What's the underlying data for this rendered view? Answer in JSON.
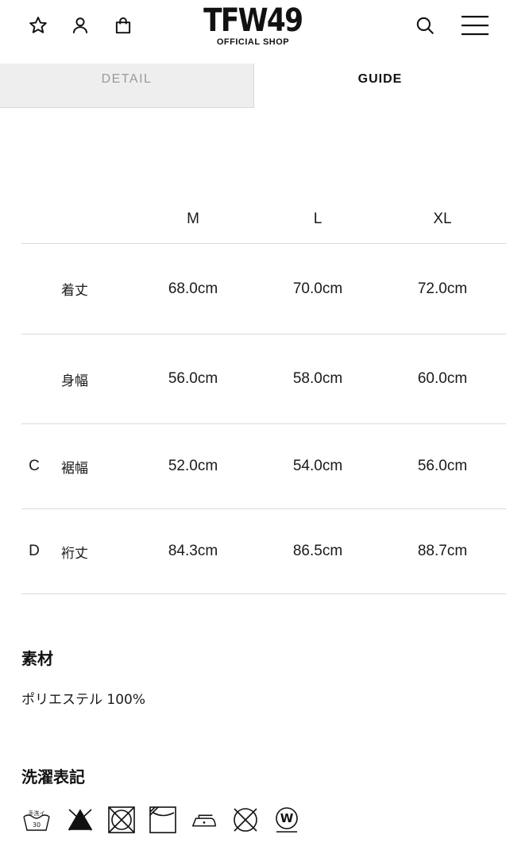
{
  "header": {
    "logo_text": "TFW49",
    "logo_subtitle": "OFFICIAL SHOP",
    "icons": [
      "star-icon",
      "user-icon",
      "bag-icon",
      "search-icon",
      "menu-icon"
    ]
  },
  "tabs": [
    {
      "label": "DETAIL",
      "active": false
    },
    {
      "label": "GUIDE",
      "active": true
    }
  ],
  "size_table": {
    "columns": [
      "M",
      "L",
      "XL"
    ],
    "rows": [
      {
        "code": "",
        "name": "着丈",
        "values": [
          "68.0cm",
          "70.0cm",
          "72.0cm"
        ]
      },
      {
        "code": "",
        "name": "身幅",
        "values": [
          "56.0cm",
          "58.0cm",
          "60.0cm"
        ]
      },
      {
        "code": "C",
        "name": "裾幅",
        "values": [
          "52.0cm",
          "54.0cm",
          "56.0cm"
        ]
      },
      {
        "code": "D",
        "name": "裄丈",
        "values": [
          "84.3cm",
          "86.5cm",
          "88.7cm"
        ]
      }
    ]
  },
  "material": {
    "title": "素材",
    "value": "ポリエステル 100%"
  },
  "care": {
    "title": "洗濯表記",
    "wash_label": "手洗イ",
    "wash_temp": "30",
    "icons": [
      "hand-wash-30-icon",
      "no-bleach-icon",
      "no-tumble-dry-icon",
      "line-dry-shade-icon",
      "iron-low-icon",
      "no-dry-clean-icon",
      "wet-clean-icon"
    ]
  },
  "colors": {
    "tab_inactive_bg": "#eeeeee",
    "tab_inactive_text": "#9a9a9a",
    "divider": "#d9d9d9",
    "text": "#1a1a1a"
  }
}
